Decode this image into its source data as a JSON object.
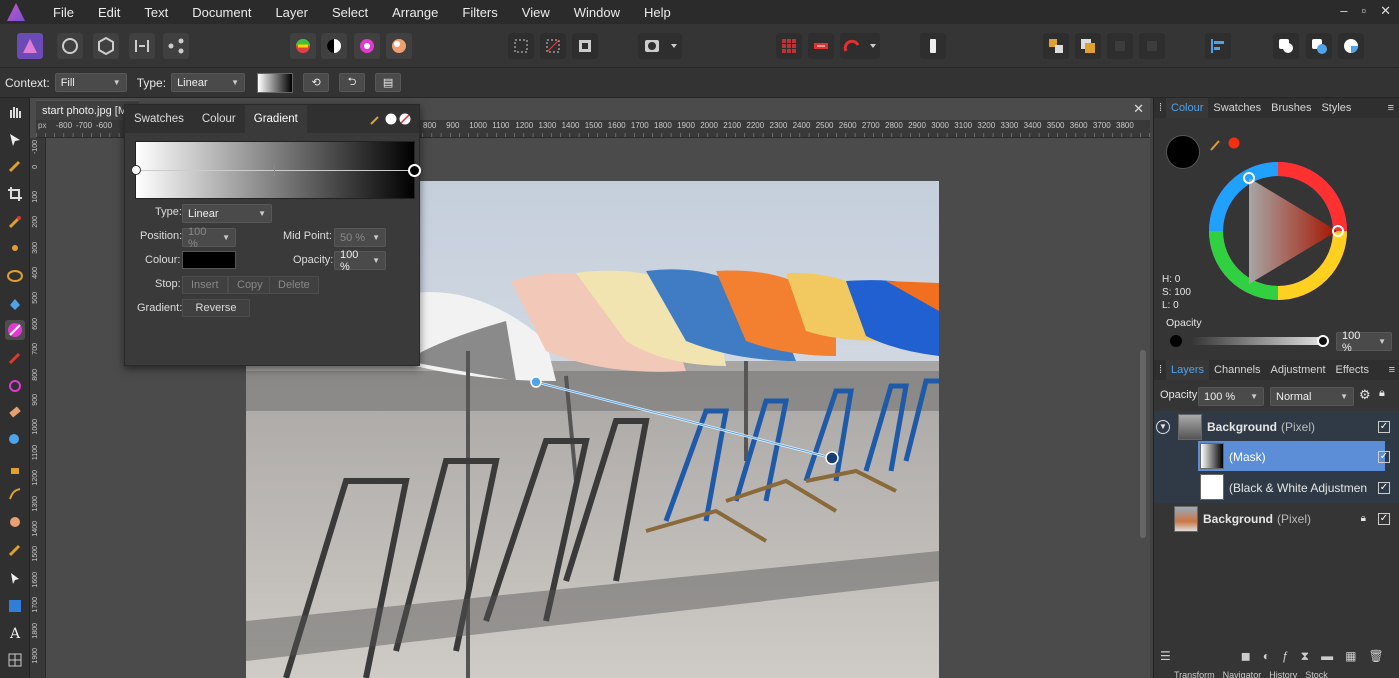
{
  "menubar": {
    "items": [
      "File",
      "Edit",
      "Text",
      "Document",
      "Layer",
      "Select",
      "Arrange",
      "Filters",
      "View",
      "Window",
      "Help"
    ],
    "window_controls": [
      "–",
      "▫",
      "✕"
    ]
  },
  "context": {
    "label": "Context:",
    "fill": "Fill",
    "type_label": "Type:",
    "type_value": "Linear"
  },
  "document": {
    "tab_title": "start photo.jpg [Mo",
    "ruler_unit": "px",
    "ruler_left_values": [
      "-800",
      "-700",
      "-600"
    ],
    "ruler_values": [
      "800",
      "900",
      "1000",
      "1100",
      "1200",
      "1300",
      "1400",
      "1500",
      "1600",
      "1700",
      "1800",
      "1900",
      "2000",
      "2100",
      "2200",
      "2300",
      "2400",
      "2500",
      "2600",
      "2700",
      "2800",
      "2900",
      "3000",
      "3100",
      "3200",
      "3300",
      "3400",
      "3500",
      "3600",
      "3700",
      "3800"
    ],
    "ruler_v_values": [
      "-100",
      "0",
      "100",
      "200",
      "300",
      "400",
      "500",
      "600",
      "700",
      "800",
      "900",
      "1000",
      "1100",
      "1200",
      "1300",
      "1400",
      "1500",
      "1600",
      "1700",
      "1800",
      "1900"
    ],
    "close": "✕"
  },
  "gradient_popup": {
    "tabs": [
      "Swatches",
      "Colour",
      "Gradient"
    ],
    "active_tab": "Gradient",
    "type_label": "Type:",
    "type_value": "Linear",
    "position_label": "Position:",
    "position_value": "100 %",
    "midpoint_label": "Mid Point:",
    "midpoint_value": "50 %",
    "colour_label": "Colour:",
    "opacity_label": "Opacity:",
    "opacity_value": "100 %",
    "stop_label": "Stop:",
    "insert": "Insert",
    "copy": "Copy",
    "delete": "Delete",
    "gradient_label": "Gradient:",
    "reverse": "Reverse"
  },
  "colour_panel": {
    "tabs": [
      "Colour",
      "Swatches",
      "Brushes",
      "Styles"
    ],
    "active": "Colour",
    "h": "H: 0",
    "s": "S: 100",
    "l": "L: 0",
    "opacity_label": "Opacity",
    "opacity_value": "100 %"
  },
  "layers_panel": {
    "tabs": [
      "Layers",
      "Channels",
      "Adjustment",
      "Effects"
    ],
    "active": "Layers",
    "opacity_label": "Opacity:",
    "opacity_value": "100 %",
    "blend": "Normal",
    "layers": [
      {
        "name": "Background",
        "type": "(Pixel)",
        "checked": true
      },
      {
        "name": "(Mask)",
        "type": "",
        "checked": true
      },
      {
        "name": "(Black & White Adjustmen",
        "type": "",
        "checked": true
      },
      {
        "name": "Background",
        "type": "(Pixel)",
        "checked": true,
        "locked": true
      }
    ]
  },
  "bottom_tabs": [
    "Transform",
    "Navigator",
    "History",
    "Stock"
  ],
  "colors": {
    "accent": "#4fa3e8",
    "selected_layer": "#5b8ed6",
    "bg": "#424242"
  }
}
